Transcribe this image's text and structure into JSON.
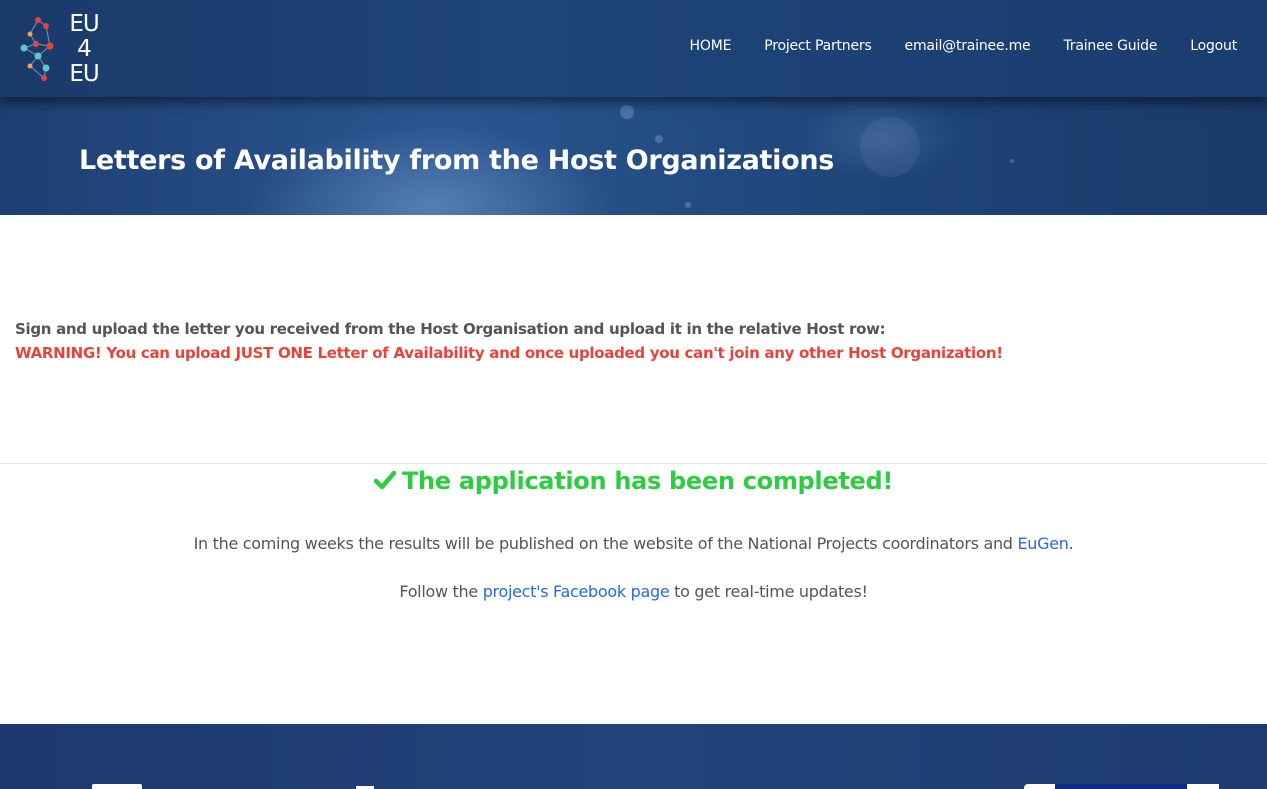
{
  "header": {
    "logo": {
      "line1": "EU",
      "line2": "4",
      "line3": "EU"
    },
    "nav": [
      {
        "label": "HOME"
      },
      {
        "label": "Project Partners"
      },
      {
        "label": "email@trainee.me"
      },
      {
        "label": "Trainee Guide"
      },
      {
        "label": "Logout"
      }
    ]
  },
  "banner": {
    "title": "Letters of Availability from the Host Organizations"
  },
  "content": {
    "instruction": "Sign and upload the letter you received from the Host Organisation and upload it in the relative Host row:",
    "warning": "WARNING! You can upload JUST ONE Letter of Availability and once uploaded you can't join any other Host Organization!",
    "success": "The application has been completed!",
    "results_prefix": "In the coming weeks the results will be published on the website of the National Projects coordinators and ",
    "results_link": "EuGen",
    "results_suffix": ".",
    "follow_prefix": "Follow the ",
    "follow_link": "project's Facebook page",
    "follow_suffix": " to get real-time updates!"
  },
  "colors": {
    "header_bg": "#1e4478",
    "warning": "#e8433a",
    "success": "#2ecc40",
    "link": "#2a6ad8",
    "text": "#555555"
  },
  "icons": {
    "success_icon": "checkmark-icon",
    "logo_icon": "network-nodes-icon"
  }
}
